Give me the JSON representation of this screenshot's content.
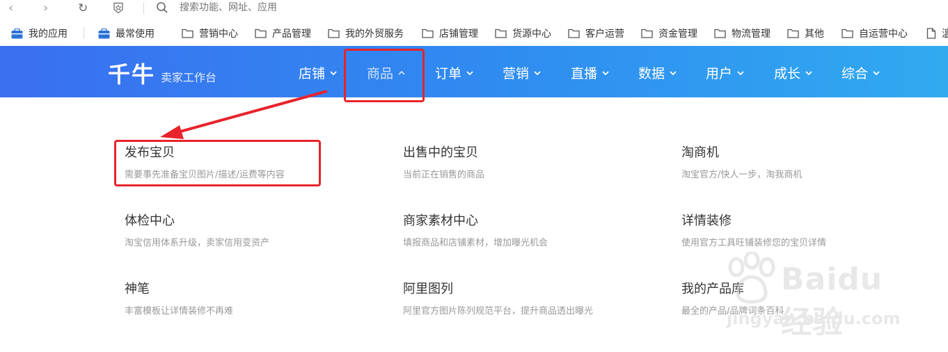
{
  "browser": {
    "address_placeholder": "搜索功能、网址、应用",
    "icons": [
      "back-icon",
      "forward-icon",
      "reload-icon",
      "shield-star-icon",
      "search-icon"
    ]
  },
  "bookmarks": [
    {
      "label": "我的应用",
      "icon": "briefcase-icon"
    },
    {
      "label": "最常使用",
      "icon": "briefcase-icon"
    },
    {
      "label": "营销中心",
      "icon": "folder-icon"
    },
    {
      "label": "产品管理",
      "icon": "folder-icon"
    },
    {
      "label": "我的外贸服务",
      "icon": "folder-icon"
    },
    {
      "label": "店铺管理",
      "icon": "folder-icon"
    },
    {
      "label": "货源中心",
      "icon": "folder-icon"
    },
    {
      "label": "客户运营",
      "icon": "folder-icon"
    },
    {
      "label": "资金管理",
      "icon": "folder-icon"
    },
    {
      "label": "物流管理",
      "icon": "folder-icon"
    },
    {
      "label": "其他",
      "icon": "folder-icon"
    },
    {
      "label": "自运营中心",
      "icon": "folder-icon"
    },
    {
      "label": "溫",
      "icon": "document-icon"
    }
  ],
  "header": {
    "logo": "千牛",
    "subtitle": "卖家工作台",
    "nav": [
      {
        "label": "店铺",
        "active": false
      },
      {
        "label": "商品",
        "active": true
      },
      {
        "label": "订单",
        "active": false
      },
      {
        "label": "营销",
        "active": false
      },
      {
        "label": "直播",
        "active": false
      },
      {
        "label": "数据",
        "active": false
      },
      {
        "label": "用户",
        "active": false
      },
      {
        "label": "成长",
        "active": false
      },
      {
        "label": "综合",
        "active": false
      }
    ]
  },
  "menu": [
    {
      "title": "发布宝贝",
      "desc": "需要事先准备宝贝图片/描述/运费等内容"
    },
    {
      "title": "出售中的宝贝",
      "desc": "当前正在销售的商品"
    },
    {
      "title": "淘商机",
      "desc": "淘宝官方/快人一步，淘我商机"
    },
    {
      "title": "体检中心",
      "desc": "淘宝信用体系升级，卖家信用变资产"
    },
    {
      "title": "商家素材中心",
      "desc": "填报商品和店铺素材，增加曝光机会"
    },
    {
      "title": "详情装修",
      "desc": "使用官方工具旺铺装修您的宝贝详情"
    },
    {
      "title": "神笔",
      "desc": "丰富模板让详情装修不再难"
    },
    {
      "title": "阿里图列",
      "desc": "阿里官方图片陈列规范平台，提升商品透出曝光"
    },
    {
      "title": "我的产品库",
      "desc": "最全的产品/品牌词条百科"
    }
  ],
  "watermark": {
    "brand": "Baidu 经验",
    "url": "jingyan.baidu.com"
  },
  "colors": {
    "header_start": "#3a6ff0",
    "header_end": "#31aaf0",
    "annotation": "#e8232b"
  }
}
